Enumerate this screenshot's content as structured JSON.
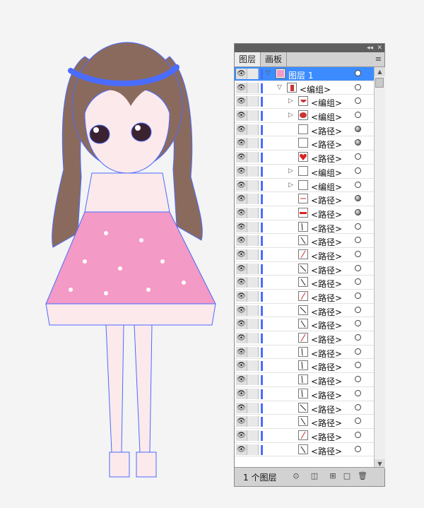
{
  "panel": {
    "tabs": [
      "图层",
      "画板"
    ],
    "collapse_glyph": "◂◂",
    "close_glyph": "✕",
    "menu_glyph": "≡",
    "layer_count": "1 个图层",
    "bottom_icons": [
      "locate-object-icon",
      "make-clipping-mask-icon",
      "create-sublayer-icon",
      "new-layer-icon",
      "delete-icon"
    ]
  },
  "rows": [
    {
      "label": "图层 1",
      "indent": 0,
      "expand": "open",
      "thumb": "layer",
      "target": "empty",
      "selected": true
    },
    {
      "label": "<编组>",
      "indent": 1,
      "expand": "open",
      "thumb": "group-figure",
      "target": "empty"
    },
    {
      "label": "<编组>",
      "indent": 2,
      "expand": "closed",
      "thumb": "mouth",
      "target": "empty"
    },
    {
      "label": "<编组>",
      "indent": 2,
      "expand": "closed",
      "thumb": "red-blob",
      "target": "empty"
    },
    {
      "label": "<路径>",
      "indent": 2,
      "expand": "",
      "thumb": "blank",
      "target": "filled"
    },
    {
      "label": "<路径>",
      "indent": 2,
      "expand": "",
      "thumb": "blank",
      "target": "filled"
    },
    {
      "label": "<路径>",
      "indent": 2,
      "expand": "",
      "thumb": "heart",
      "target": "empty"
    },
    {
      "label": "<编组>",
      "indent": 2,
      "expand": "closed",
      "thumb": "blank",
      "target": "empty"
    },
    {
      "label": "<编组>",
      "indent": 2,
      "expand": "closed",
      "thumb": "blank",
      "target": "empty"
    },
    {
      "label": "<路径>",
      "indent": 2,
      "expand": "",
      "thumb": "dash",
      "target": "filled"
    },
    {
      "label": "<路径>",
      "indent": 2,
      "expand": "",
      "thumb": "red-bar",
      "target": "filled"
    },
    {
      "label": "<路径>",
      "indent": 2,
      "expand": "",
      "thumb": "line-v",
      "target": "empty"
    },
    {
      "label": "<路径>",
      "indent": 2,
      "expand": "",
      "thumb": "line-d",
      "target": "empty"
    },
    {
      "label": "<路径>",
      "indent": 2,
      "expand": "",
      "thumb": "line-d2",
      "target": "empty"
    },
    {
      "label": "<路径>",
      "indent": 2,
      "expand": "",
      "thumb": "line-d3",
      "target": "empty"
    },
    {
      "label": "<路径>",
      "indent": 2,
      "expand": "",
      "thumb": "line-d",
      "target": "empty"
    },
    {
      "label": "<路径>",
      "indent": 2,
      "expand": "",
      "thumb": "line-d2",
      "target": "empty"
    },
    {
      "label": "<路径>",
      "indent": 2,
      "expand": "",
      "thumb": "line-d3",
      "target": "empty"
    },
    {
      "label": "<路径>",
      "indent": 2,
      "expand": "",
      "thumb": "line-d",
      "target": "empty"
    },
    {
      "label": "<路径>",
      "indent": 2,
      "expand": "",
      "thumb": "line-d2",
      "target": "empty"
    },
    {
      "label": "<路径>",
      "indent": 2,
      "expand": "",
      "thumb": "line-v",
      "target": "empty"
    },
    {
      "label": "<路径>",
      "indent": 2,
      "expand": "",
      "thumb": "line-v",
      "target": "empty"
    },
    {
      "label": "<路径>",
      "indent": 2,
      "expand": "",
      "thumb": "line-v",
      "target": "empty"
    },
    {
      "label": "<路径>",
      "indent": 2,
      "expand": "",
      "thumb": "line-v",
      "target": "empty"
    },
    {
      "label": "<路径>",
      "indent": 2,
      "expand": "",
      "thumb": "line-d3",
      "target": "empty"
    },
    {
      "label": "<路径>",
      "indent": 2,
      "expand": "",
      "thumb": "line-d",
      "target": "empty"
    },
    {
      "label": "<路径>",
      "indent": 2,
      "expand": "",
      "thumb": "line-d2",
      "target": "empty"
    },
    {
      "label": "<路径>",
      "indent": 2,
      "expand": "",
      "thumb": "line-d",
      "target": "empty"
    }
  ],
  "colors": {
    "selection": "#3c8cff",
    "layer_color": "#4a6cff",
    "anchor_color": "#4a6cff",
    "hair": "#8b6a5e",
    "dress": "#f39ac7"
  }
}
